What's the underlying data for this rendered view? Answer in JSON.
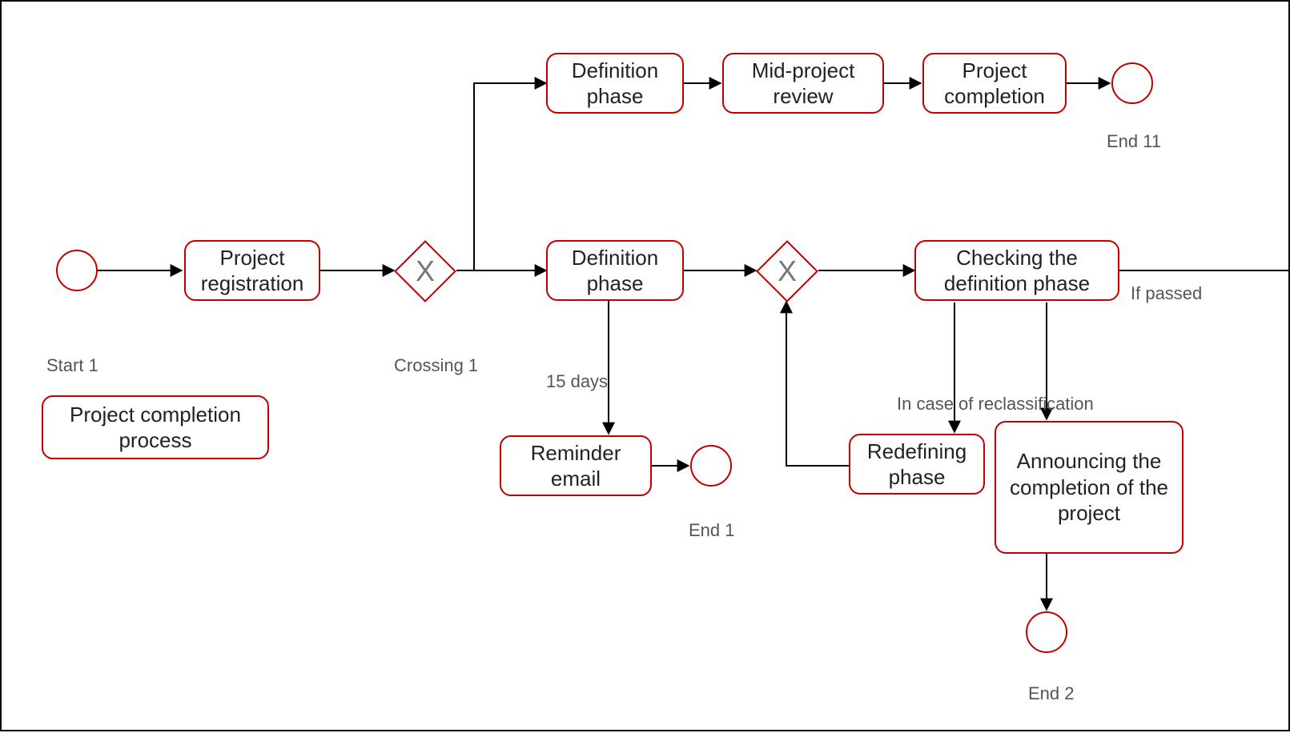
{
  "tasks": {
    "project_registration": "Project registration",
    "definition_phase_top": "Definition phase",
    "mid_project_review": "Mid-project review",
    "project_completion": "Project completion",
    "definition_phase_mid": "Definition phase",
    "reminder_email": "Reminder email",
    "checking_definition": "Checking the definition phase",
    "redefining_phase": "Redefining phase",
    "announcing_completion": "Announcing the completion of the project",
    "process_title": "Project completion process"
  },
  "labels": {
    "start1": "Start 1",
    "crossing1": "Crossing 1",
    "end11": "End 11",
    "end1": "End 1",
    "end2": "End 2",
    "fifteen_days": "15 days",
    "if_passed": "If passed",
    "reclassification": "In case of reclassification"
  }
}
